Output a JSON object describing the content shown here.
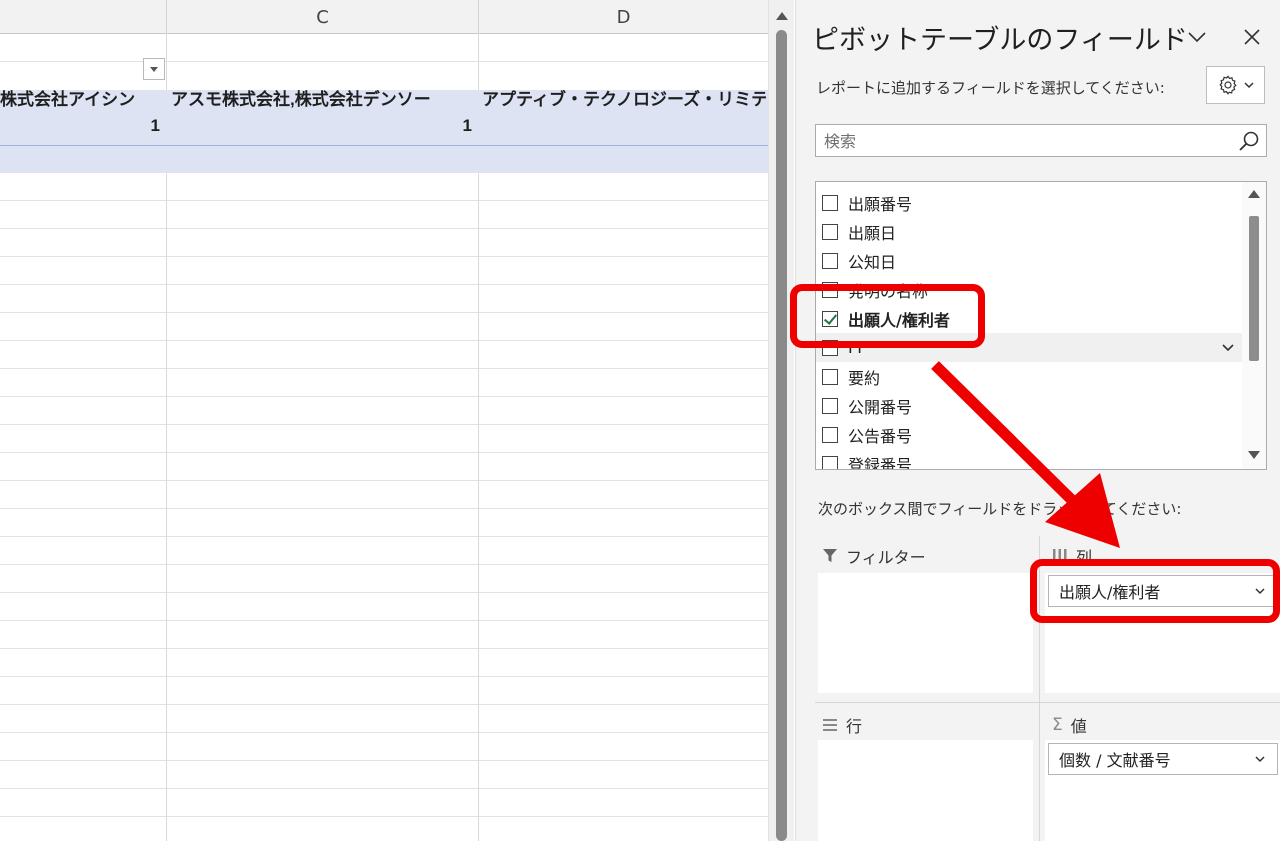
{
  "spreadsheet": {
    "columns": [
      "C",
      "D"
    ],
    "pivot_headers": [
      "株式会社アイシン",
      "アスモ株式会社,株式会社デンソー",
      "アプティブ・テクノロジーズ・リミテッド"
    ],
    "pivot_values": [
      "1",
      "1"
    ]
  },
  "pane": {
    "title": "ピボットテーブルのフィールド",
    "subtitle": "レポートに追加するフィールドを選択してください:",
    "search_placeholder": "検索",
    "fields": [
      {
        "label": "出願番号",
        "checked": false
      },
      {
        "label": "出願日",
        "checked": false
      },
      {
        "label": "公知日",
        "checked": false
      },
      {
        "label": "発明の名称",
        "checked": false
      },
      {
        "label": "出願人/権利者",
        "checked": true
      },
      {
        "label": "FI",
        "checked": false
      },
      {
        "label": "要約",
        "checked": false
      },
      {
        "label": "公開番号",
        "checked": false
      },
      {
        "label": "公告番号",
        "checked": false
      },
      {
        "label": "登録番号",
        "checked": false
      }
    ],
    "drag_hint": "次のボックス間でフィールドをドラッグしてください:",
    "areas": {
      "filter_label": "フィルター",
      "columns_label": "列",
      "rows_label": "行",
      "values_label": "値",
      "columns_pill": "出願人/権利者",
      "values_pill": "個数 / 文献番号"
    }
  },
  "colors": {
    "pivot_band": "#dde3f3",
    "annotation": "#ee0000",
    "check_green": "#217346"
  }
}
